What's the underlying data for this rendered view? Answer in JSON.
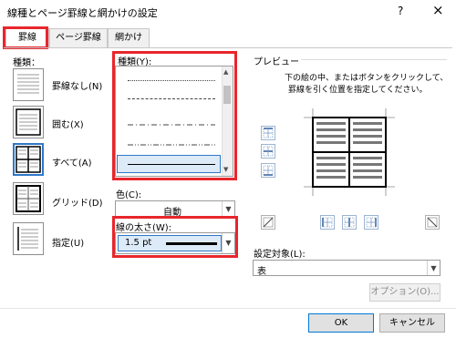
{
  "window": {
    "title": "線種とページ罫線と網かけの設定",
    "help_label": "?",
    "close_label": "×"
  },
  "tabs": [
    {
      "label": "罫線"
    },
    {
      "label": "ページ罫線"
    },
    {
      "label": "網かけ"
    }
  ],
  "setting": {
    "header": "種類：",
    "options": [
      {
        "label": "罫線なし(N)"
      },
      {
        "label": "囲む(X)"
      },
      {
        "label": "すべて(A)"
      },
      {
        "label": "グリッド(D)"
      },
      {
        "label": "指定(U)"
      }
    ]
  },
  "style": {
    "label": "種類(Y):"
  },
  "color": {
    "label": "色(C):",
    "value": "自動"
  },
  "width": {
    "label": "線の太さ(W):",
    "value": "1.5 pt"
  },
  "preview": {
    "header": "プレビュー",
    "instruction_line1": "下の絵の中、またはボタンをクリックして、",
    "instruction_line2": "罫線を引く位置を指定してください。"
  },
  "apply_to": {
    "label": "設定対象(L):",
    "value": "表"
  },
  "buttons": {
    "options": "オプション(O)...",
    "ok": "OK",
    "cancel": "キャンセル"
  },
  "colors": {
    "highlight": "#e8262c",
    "selection": "#2f78c8"
  }
}
